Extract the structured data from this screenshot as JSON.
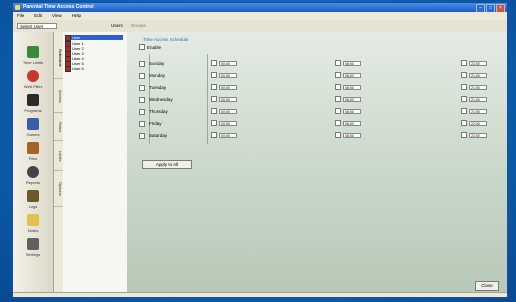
{
  "window": {
    "title": "Parental Time Access Control"
  },
  "menu": [
    "File",
    "Edit",
    "View",
    "Help"
  ],
  "toolbar": {
    "select_value": "Select User",
    "tab1": "Users",
    "tab2": "Groups"
  },
  "sidebar": [
    {
      "label": "Time Limits",
      "color": "#3a8a3a"
    },
    {
      "label": "Web Filter",
      "color": "#c8372d"
    },
    {
      "label": "Programs",
      "color": "#2b2b2b"
    },
    {
      "label": "Games",
      "color": "#3a5fa8"
    },
    {
      "label": "Files",
      "color": "#a5632a"
    },
    {
      "label": "Reports",
      "color": "#444444"
    },
    {
      "label": "Logs",
      "color": "#6a5a2a"
    },
    {
      "label": "Notes",
      "color": "#e0c24a"
    },
    {
      "label": "Settings",
      "color": "#606060"
    }
  ],
  "vtabs": [
    "Schedule",
    "Access",
    "Rules",
    "Limits",
    "Options"
  ],
  "tree": [
    "User",
    "User 1",
    "User 2",
    "User 3",
    "User 4",
    "User 5",
    "User 6"
  ],
  "schedule": {
    "section_title": "Time Access Schedule",
    "enable_label": "Enable",
    "days": [
      {
        "name": "Sunday",
        "times": [
          "00:00",
          "08:00",
          "22:00"
        ]
      },
      {
        "name": "Monday",
        "times": [
          "00:00",
          "08:00",
          "21:00"
        ]
      },
      {
        "name": "Tuesday",
        "times": [
          "00:00",
          "08:00",
          "21:00"
        ]
      },
      {
        "name": "Wednesday",
        "times": [
          "00:00",
          "08:00",
          "21:00"
        ]
      },
      {
        "name": "Thursday",
        "times": [
          "00:00",
          "08:00",
          "21:00"
        ]
      },
      {
        "name": "Friday",
        "times": [
          "00:00",
          "08:00",
          "22:00"
        ]
      },
      {
        "name": "Saturday",
        "times": [
          "00:00",
          "08:00",
          "22:00"
        ]
      }
    ],
    "apply_label": "Apply to All"
  },
  "close_label": "Close"
}
